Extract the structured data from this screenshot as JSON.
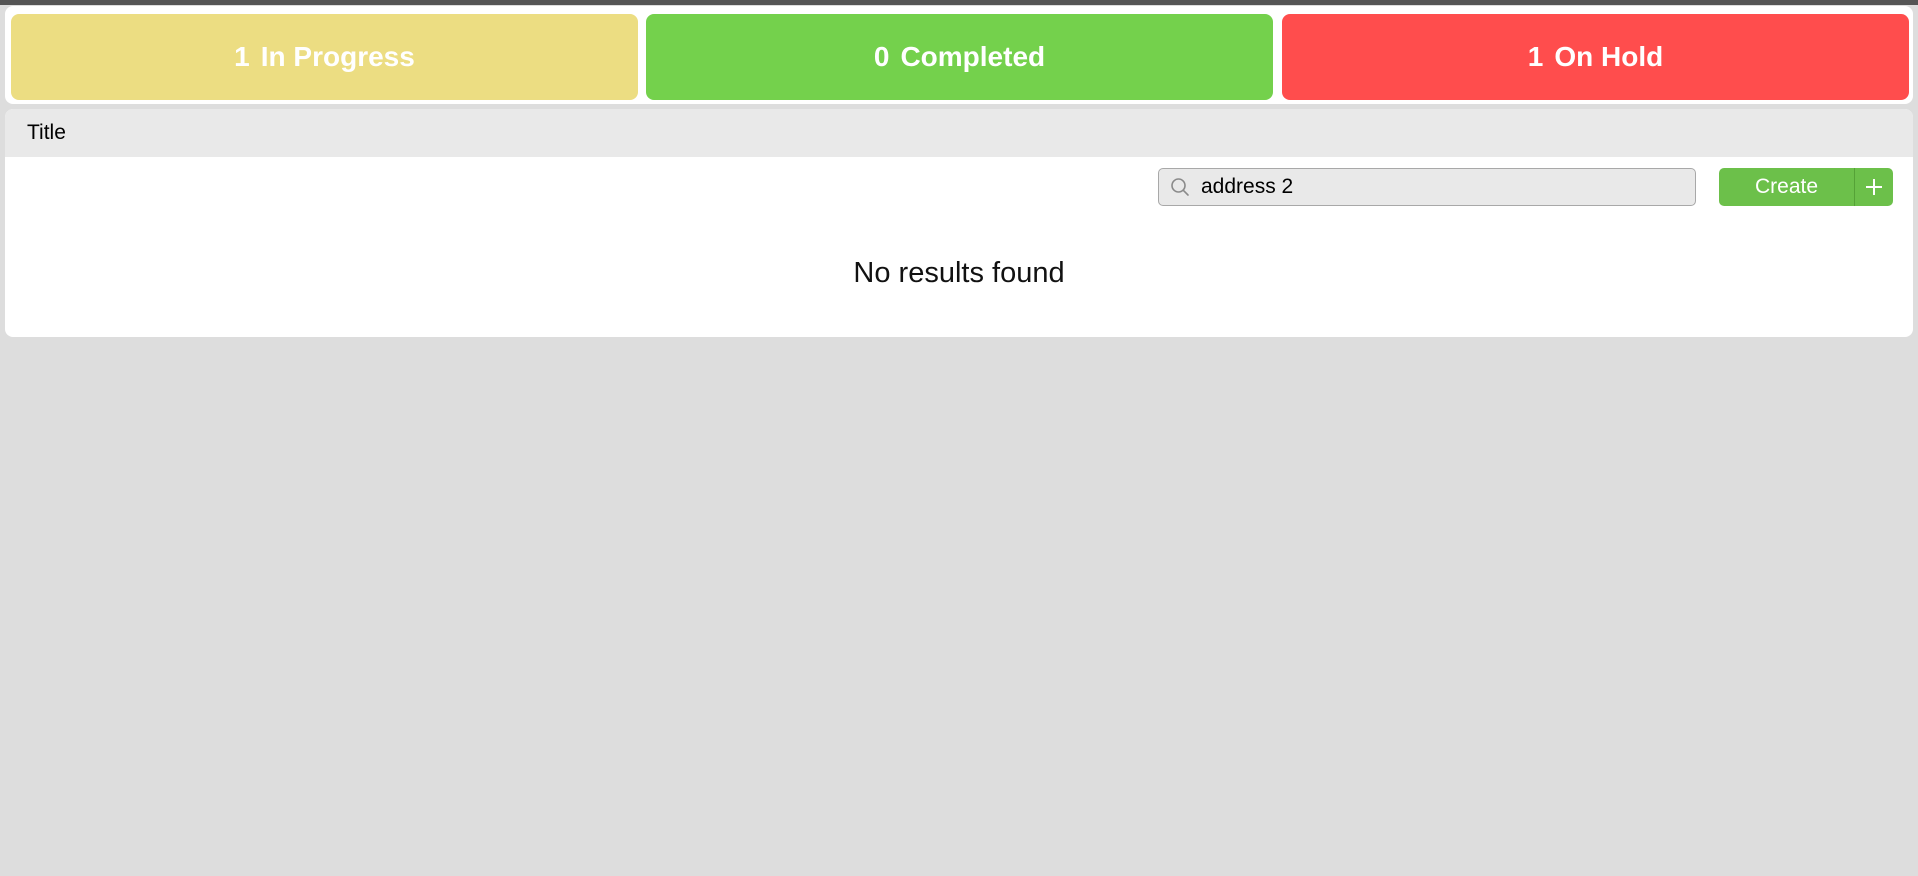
{
  "status_cards": [
    {
      "count": "1",
      "label": "In Progress",
      "color": "#ecdd82"
    },
    {
      "count": "0",
      "label": "Completed",
      "color": "#74d14c"
    },
    {
      "count": "1",
      "label": "On Hold",
      "color": "#ff4d4d"
    }
  ],
  "table": {
    "header_title": "Title",
    "empty_message": "No results found"
  },
  "search": {
    "value": "address 2",
    "icon": "search-icon"
  },
  "actions": {
    "create_label": "Create",
    "create_color": "#6cc04a",
    "add_icon": "plus-icon"
  }
}
